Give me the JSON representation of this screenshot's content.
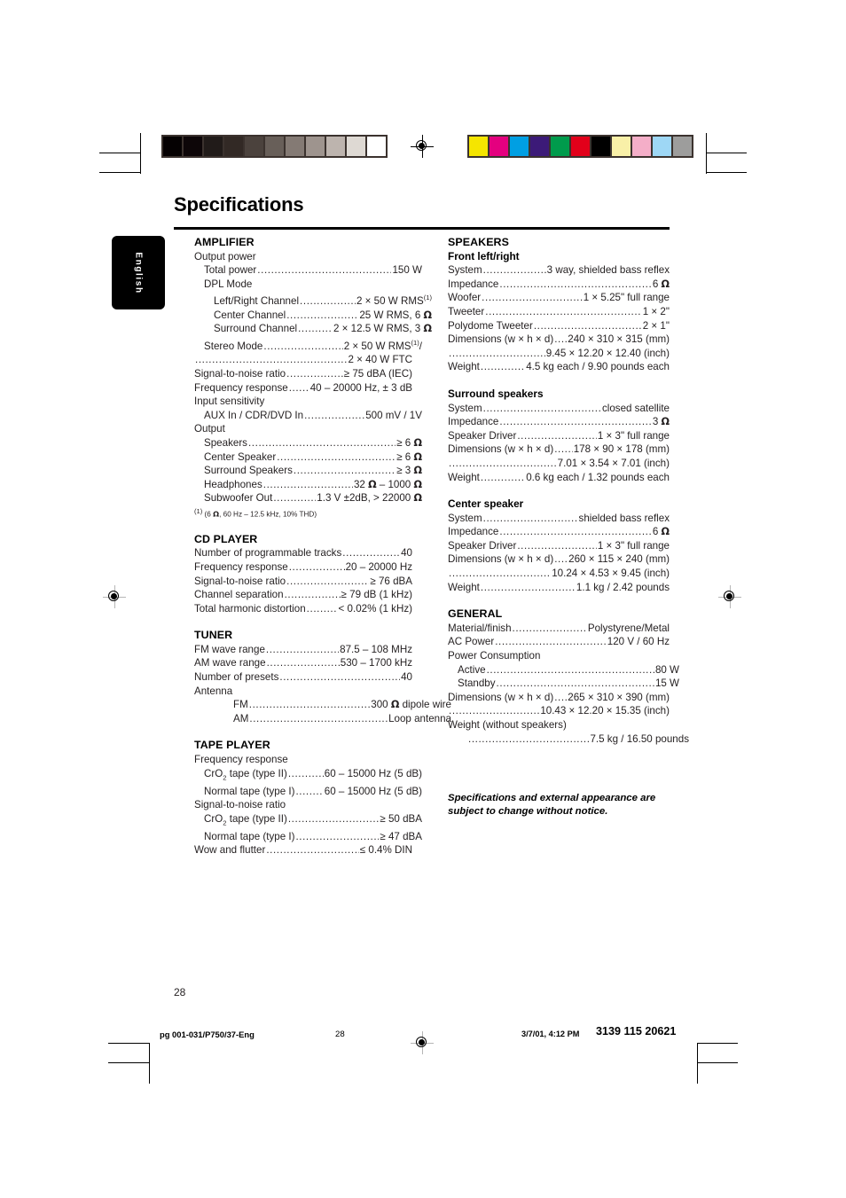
{
  "page": {
    "title": "Specifications",
    "language_tab": "English",
    "folio": "28"
  },
  "marks": {
    "grayscale_bar": [
      "#050102",
      "#0d0608",
      "#211b19",
      "#322925",
      "#4b423d",
      "#685f59",
      "#847a74",
      "#9e948e",
      "#bdb4ae",
      "#ded9d3",
      "#ffffff"
    ],
    "color_bar": [
      "#f5e500",
      "#e4007f",
      "#009fe3",
      "#3c1a78",
      "#009b4c",
      "#e2001a",
      "#000000",
      "#f9f0a8",
      "#f4aec8",
      "#9ed7f5",
      "#9d9d9c"
    ]
  },
  "left_column": [
    {
      "type": "section",
      "heading": "AMPLIFIER",
      "rows": [
        {
          "kind": "plain",
          "indent": 0,
          "label": "Output power"
        },
        {
          "kind": "leader",
          "indent": 1,
          "label": "Total power",
          "value": "150 W"
        },
        {
          "kind": "plain",
          "indent": 1,
          "label": "DPL Mode"
        },
        {
          "kind": "leader",
          "indent": 2,
          "label": "Left/Right Channel",
          "value": "2 × 50 W RMS(1)"
        },
        {
          "kind": "leader",
          "indent": 2,
          "label": "Center Channel",
          "value": "25 W RMS, 6 Ω"
        },
        {
          "kind": "leader",
          "indent": 2,
          "label": "Surround Channel",
          "value": "2 × 12.5 W RMS, 3 Ω"
        },
        {
          "kind": "leader",
          "indent": 1,
          "label": "Stereo Mode",
          "value": "2 × 50 W RMS(1)/"
        },
        {
          "kind": "leader",
          "indent": 0,
          "label": "",
          "value": "2 × 40 W FTC"
        },
        {
          "kind": "leader",
          "indent": 0,
          "label": "Signal-to-noise ratio",
          "value": "≥ 75 dBA (IEC)"
        },
        {
          "kind": "leader",
          "indent": 0,
          "label": "Frequency response",
          "value": "40 – 20000 Hz, ± 3 dB"
        },
        {
          "kind": "plain",
          "indent": 0,
          "label": "Input sensitivity"
        },
        {
          "kind": "leader",
          "indent": 1,
          "label": "AUX In / CDR/DVD In",
          "value": "500 mV / 1V"
        },
        {
          "kind": "plain",
          "indent": 0,
          "label": "Output"
        },
        {
          "kind": "leader",
          "indent": 1,
          "label": "Speakers",
          "value": "≥ 6 Ω"
        },
        {
          "kind": "leader",
          "indent": 1,
          "label": "Center Speaker",
          "value": "≥ 6 Ω"
        },
        {
          "kind": "leader",
          "indent": 1,
          "label": "Surround Speakers",
          "value": "≥ 3 Ω"
        },
        {
          "kind": "leader",
          "indent": 1,
          "label": "Headphones",
          "value": "32 Ω – 1000 Ω"
        },
        {
          "kind": "leader",
          "indent": 1,
          "label": "Subwoofer Out",
          "value": "1.3 V ±2dB, > 22000 Ω"
        }
      ],
      "footnote": "(1) (6 Ω, 60 Hz – 12.5 kHz, 10% THD)"
    },
    {
      "type": "section",
      "heading": "CD PLAYER",
      "rows": [
        {
          "kind": "leader",
          "indent": 0,
          "label": "Number of programmable tracks",
          "value": "40"
        },
        {
          "kind": "leader",
          "indent": 0,
          "label": "Frequency response",
          "value": "20 – 20000 Hz"
        },
        {
          "kind": "leader",
          "indent": 0,
          "label": "Signal-to-noise ratio",
          "value": "≥ 76 dBA"
        },
        {
          "kind": "leader",
          "indent": 0,
          "label": "Channel separation",
          "value": "≥ 79 dB (1 kHz)"
        },
        {
          "kind": "leader",
          "indent": 0,
          "label": "Total harmonic distortion",
          "value": "< 0.02% (1 kHz)"
        }
      ]
    },
    {
      "type": "section",
      "heading": "TUNER",
      "rows": [
        {
          "kind": "leader",
          "indent": 0,
          "label": "FM wave range",
          "value": "87.5 – 108 MHz"
        },
        {
          "kind": "leader",
          "indent": 0,
          "label": "AM wave range",
          "value": "530 – 1700 kHz"
        },
        {
          "kind": "leader",
          "indent": 0,
          "label": "Number of presets",
          "value": "40"
        },
        {
          "kind": "plain",
          "indent": 0,
          "label": "Antenna"
        },
        {
          "kind": "leader",
          "indent": 3,
          "label": "FM",
          "value": "300 Ω dipole wire"
        },
        {
          "kind": "leader",
          "indent": 3,
          "label": "AM",
          "value": "Loop antenna"
        }
      ]
    },
    {
      "type": "section",
      "heading": "TAPE PLAYER",
      "rows": [
        {
          "kind": "plain",
          "indent": 0,
          "label": "Frequency response"
        },
        {
          "kind": "leader",
          "indent": 1,
          "label": "CrO2 tape (type II)",
          "value": "60 – 15000 Hz (5 dB)"
        },
        {
          "kind": "leader",
          "indent": 1,
          "label": "Normal tape (type I)",
          "value": "60 – 15000 Hz (5 dB)"
        },
        {
          "kind": "plain",
          "indent": 0,
          "label": "Signal-to-noise ratio"
        },
        {
          "kind": "leader",
          "indent": 1,
          "label": "CrO2 tape (type II)",
          "value": "≥ 50 dBA"
        },
        {
          "kind": "leader",
          "indent": 1,
          "label": "Normal tape (type I)",
          "value": "≥ 47 dBA"
        },
        {
          "kind": "leader",
          "indent": 0,
          "label": "Wow and flutter",
          "value": "≤ 0.4% DIN"
        }
      ]
    }
  ],
  "right_column": [
    {
      "type": "section",
      "heading": "SPEAKERS",
      "subheading": "Front left/right",
      "rows": [
        {
          "kind": "leader",
          "indent": 0,
          "label": "System",
          "value": "3 way, shielded bass reflex"
        },
        {
          "kind": "leader",
          "indent": 0,
          "label": "Impedance",
          "value": "6 Ω"
        },
        {
          "kind": "leader",
          "indent": 0,
          "label": "Woofer",
          "value": "1 × 5.25\" full range"
        },
        {
          "kind": "leader",
          "indent": 0,
          "label": "Tweeter",
          "value": "1 × 2\""
        },
        {
          "kind": "leader",
          "indent": 0,
          "label": "Polydome Tweeter",
          "value": "2 × 1\""
        },
        {
          "kind": "leader",
          "indent": 0,
          "label": "Dimensions (w × h × d)",
          "value": "240 × 310 × 315 (mm)"
        },
        {
          "kind": "leader",
          "indent": 0,
          "label": "",
          "value": "9.45 × 12.20 × 12.40 (inch)"
        },
        {
          "kind": "leader",
          "indent": 0,
          "label": "Weight",
          "value": "4.5 kg each / 9.90 pounds each"
        }
      ]
    },
    {
      "type": "section",
      "subheading": "Surround speakers",
      "rows": [
        {
          "kind": "leader",
          "indent": 0,
          "label": "System",
          "value": "closed satellite"
        },
        {
          "kind": "leader",
          "indent": 0,
          "label": "Impedance",
          "value": "3 Ω"
        },
        {
          "kind": "leader",
          "indent": 0,
          "label": "Speaker Driver",
          "value": "1 × 3\" full range"
        },
        {
          "kind": "leader",
          "indent": 0,
          "label": "Dimensions (w × h × d)",
          "value": "178 × 90 × 178 (mm)"
        },
        {
          "kind": "leader",
          "indent": 0,
          "label": "",
          "value": "7.01 × 3.54 × 7.01 (inch)"
        },
        {
          "kind": "leader",
          "indent": 0,
          "label": "Weight",
          "value": "0.6 kg each / 1.32 pounds each"
        }
      ]
    },
    {
      "type": "section",
      "subheading": "Center speaker",
      "rows": [
        {
          "kind": "leader",
          "indent": 0,
          "label": "System",
          "value": "shielded bass reflex"
        },
        {
          "kind": "leader",
          "indent": 0,
          "label": "Impedance",
          "value": "6 Ω"
        },
        {
          "kind": "leader",
          "indent": 0,
          "label": "Speaker Driver",
          "value": "1 × 3\" full range"
        },
        {
          "kind": "leader",
          "indent": 0,
          "label": "Dimensions (w × h × d)",
          "value": "260 × 115 × 240 (mm)"
        },
        {
          "kind": "leader",
          "indent": 0,
          "label": "",
          "value": "10.24 × 4.53 × 9.45 (inch)"
        },
        {
          "kind": "leader",
          "indent": 0,
          "label": "Weight",
          "value": "1.1 kg / 2.42 pounds"
        }
      ]
    },
    {
      "type": "section",
      "heading": "GENERAL",
      "rows": [
        {
          "kind": "leader",
          "indent": 0,
          "label": "Material/finish",
          "value": "Polystyrene/Metal"
        },
        {
          "kind": "leader",
          "indent": 0,
          "label": "AC Power",
          "value": "120 V / 60 Hz"
        },
        {
          "kind": "plain",
          "indent": 0,
          "label": "Power Consumption"
        },
        {
          "kind": "leader",
          "indent": 1,
          "label": "Active",
          "value": "80 W"
        },
        {
          "kind": "leader",
          "indent": 1,
          "label": "Standby",
          "value": "15 W"
        },
        {
          "kind": "leader",
          "indent": 0,
          "label": "Dimensions (w × h × d)",
          "value": "265 × 310 × 390 (mm)"
        },
        {
          "kind": "leader",
          "indent": 0,
          "label": "",
          "value": "10.43 × 12.20 × 15.35 (inch)"
        },
        {
          "kind": "plain",
          "indent": 0,
          "label": "Weight (without speakers)"
        },
        {
          "kind": "leader",
          "indent": 2,
          "label": "",
          "value": "7.5 kg / 16.50 pounds"
        }
      ]
    }
  ],
  "notice": "Specifications and external appearance are subject to change without notice.",
  "footer": {
    "file": "pg 001-031/P750/37-Eng",
    "page": "28",
    "date": "3/7/01, 4:12 PM",
    "code": "3139 115 20621"
  }
}
